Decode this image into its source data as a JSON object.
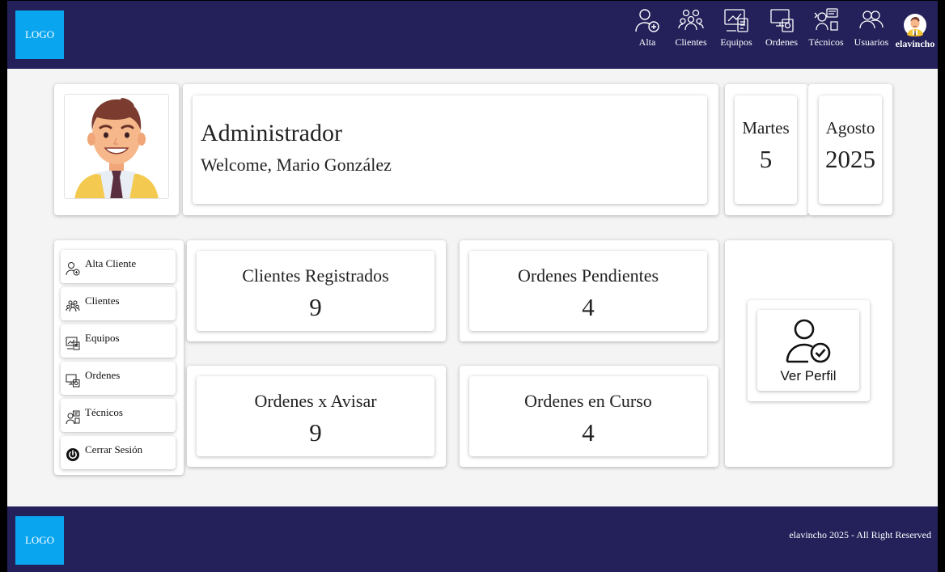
{
  "header": {
    "logo": "LOGO",
    "nav": [
      {
        "label": "Alta",
        "icon": "user-plus-icon"
      },
      {
        "label": "Clientes",
        "icon": "users-group-icon"
      },
      {
        "label": "Equipos",
        "icon": "equipment-icon"
      },
      {
        "label": "Ordenes",
        "icon": "orders-icon"
      },
      {
        "label": "Técnicos",
        "icon": "technician-icon"
      },
      {
        "label": "Usuarios",
        "icon": "users-icon"
      }
    ],
    "user": {
      "name": "elavincho",
      "icon": "user-avatar-icon"
    }
  },
  "welcome": {
    "role": "Administrador",
    "message": "Welcome, Mario González"
  },
  "date": {
    "weekday": "Martes",
    "day": "5",
    "month": "Agosto",
    "year": "2025"
  },
  "sidebar": {
    "items": [
      {
        "label": "Alta Cliente",
        "icon": "user-plus-icon"
      },
      {
        "label": "Clientes",
        "icon": "users-group-icon"
      },
      {
        "label": "Equipos",
        "icon": "equipment-icon"
      },
      {
        "label": "Ordenes",
        "icon": "orders-icon"
      },
      {
        "label": "Técnicos",
        "icon": "technician-icon"
      },
      {
        "label": "Cerrar Sesión",
        "icon": "power-icon"
      }
    ]
  },
  "stats": [
    {
      "label": "Clientes Registrados",
      "value": "9"
    },
    {
      "label": "Ordenes Pendientes",
      "value": "4"
    },
    {
      "label": "Ordenes x Avisar",
      "value": "9"
    },
    {
      "label": "Ordenes en Curso",
      "value": "4"
    }
  ],
  "profile": {
    "label": "Ver Perfil",
    "icon": "user-check-icon"
  },
  "footer": {
    "logo": "LOGO",
    "copyright": "elavincho 2025 - All Right Reserved"
  },
  "colors": {
    "header_bg": "#23205a",
    "logo_bg": "#0aa5ef",
    "page_bg": "#f4f4f4"
  }
}
